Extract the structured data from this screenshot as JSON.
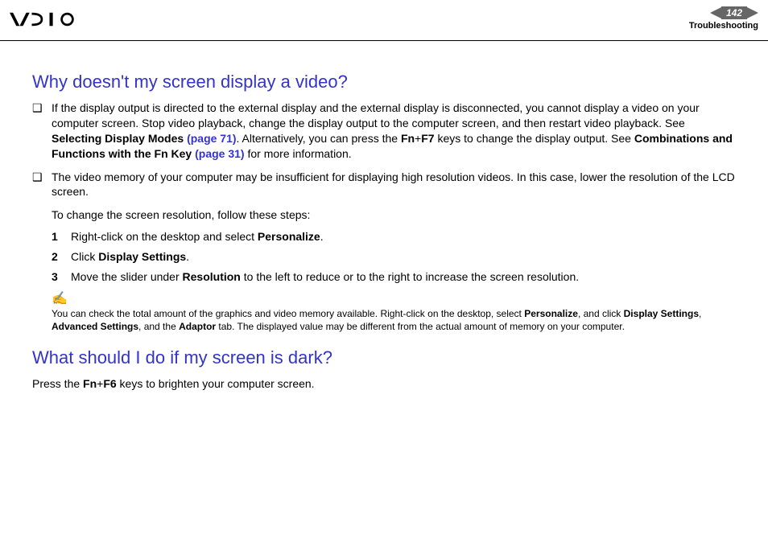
{
  "header": {
    "page_number": "142",
    "section": "Troubleshooting"
  },
  "sections": [
    {
      "heading": "Why doesn't my screen display a video?",
      "bullets": [
        {
          "pre1": "If the display output is directed to the external display and the external display is disconnected, you cannot display a video on your computer screen. Stop video playback, change the display output to the computer screen, and then restart video playback. See ",
          "bold1": "Selecting Display Modes ",
          "link1": "(page 71)",
          "mid1": ". Alternatively, you can press the ",
          "bold2": "Fn",
          "plus": "+",
          "bold3": "F7",
          "mid2": " keys to change the display output. See ",
          "bold4": "Combinations and Functions with the Fn Key ",
          "link2": "(page 31)",
          "post": " for more information."
        },
        {
          "text": "The video memory of your computer may be insufficient for displaying high resolution videos. In this case, lower the resolution of the LCD screen."
        }
      ],
      "sub_intro": "To change the screen resolution, follow these steps:",
      "steps": [
        {
          "n": "1",
          "pre": "Right-click on the desktop and select ",
          "bold": "Personalize",
          "post": "."
        },
        {
          "n": "2",
          "pre": "Click ",
          "bold": "Display Settings",
          "post": "."
        },
        {
          "n": "3",
          "pre": "Move the slider under ",
          "bold": "Resolution",
          "post": " to the left to reduce or to the right to increase the screen resolution."
        }
      ],
      "note": {
        "icon": "✍",
        "t1": "You can check the total amount of the graphics and video memory available. Right-click on the desktop, select ",
        "b1": "Personalize",
        "t2": ", and click ",
        "b2": "Display Settings",
        "t3": ", ",
        "b3": "Advanced Settings",
        "t4": ", and the ",
        "b4": "Adaptor",
        "t5": " tab. The displayed value may be different from the actual amount of memory on your computer."
      }
    },
    {
      "heading": "What should I do if my screen is dark?",
      "para": {
        "t1": "Press the ",
        "b1": "Fn",
        "plus": "+",
        "b2": "F6",
        "t2": " keys to brighten your computer screen."
      }
    }
  ]
}
